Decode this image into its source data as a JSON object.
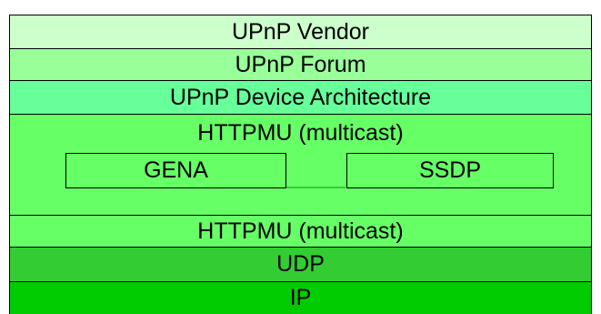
{
  "layers": [
    {
      "label": "UPnP Vendor",
      "color": "#ccffcc"
    },
    {
      "label": "UPnP Forum",
      "color": "#99ff99"
    },
    {
      "label": "UPnP Device Architecture",
      "color": "#66ff99"
    },
    {
      "label": "HTTPMU (multicast)",
      "color": "#66ff66"
    },
    {
      "label": "HTTPMU (multicast)",
      "color": "#66ff66"
    },
    {
      "label": "UDP",
      "color": "#33cc33"
    },
    {
      "label": "IP",
      "color": "#00cc00"
    }
  ],
  "protocols": {
    "gena": {
      "label": "GENA",
      "color": "#66ff66"
    },
    "ssdp": {
      "label": "SSDP",
      "color": "#66ff66"
    }
  },
  "connector_color": "#33cc33"
}
